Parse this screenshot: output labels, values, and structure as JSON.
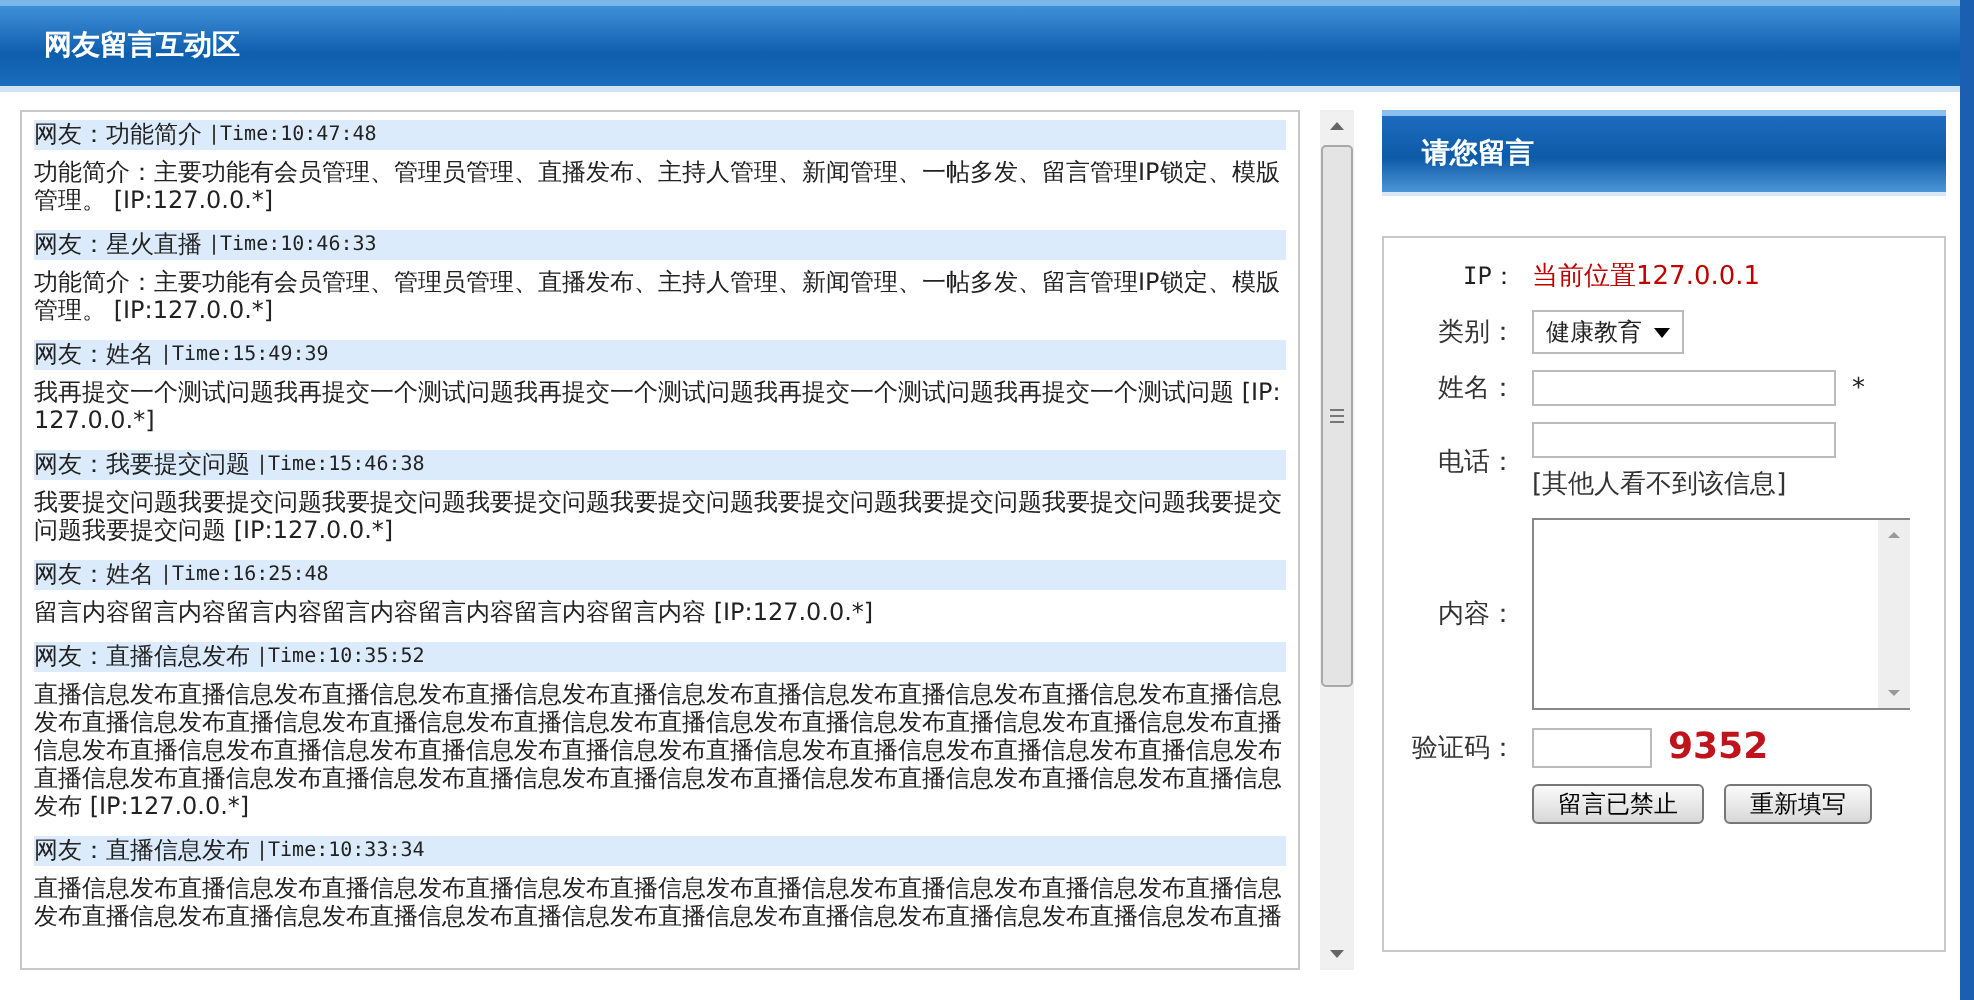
{
  "header": {
    "title": "网友留言互动区"
  },
  "messages": [
    {
      "author": "网友：功能简介",
      "time": "|Time:10:47:48",
      "body": "功能简介：主要功能有会员管理、管理员管理、直播发布、主持人管理、新闻管理、一帖多发、留言管理IP锁定、模版管理。 [IP:127.0.0.*]"
    },
    {
      "author": "网友：星火直播",
      "time": "|Time:10:46:33",
      "body": "功能简介：主要功能有会员管理、管理员管理、直播发布、主持人管理、新闻管理、一帖多发、留言管理IP锁定、模版管理。 [IP:127.0.0.*]"
    },
    {
      "author": "网友：姓名",
      "time": "|Time:15:49:39",
      "body": "我再提交一个测试问题我再提交一个测试问题我再提交一个测试问题我再提交一个测试问题我再提交一个测试问题 [IP:127.0.0.*]"
    },
    {
      "author": "网友：我要提交问题",
      "time": "|Time:15:46:38",
      "body": "我要提交问题我要提交问题我要提交问题我要提交问题我要提交问题我要提交问题我要提交问题我要提交问题我要提交问题我要提交问题 [IP:127.0.0.*]"
    },
    {
      "author": "网友：姓名",
      "time": "|Time:16:25:48",
      "body": "留言内容留言内容留言内容留言内容留言内容留言内容留言内容 [IP:127.0.0.*]"
    },
    {
      "author": "网友：直播信息发布",
      "time": "|Time:10:35:52",
      "body": "直播信息发布直播信息发布直播信息发布直播信息发布直播信息发布直播信息发布直播信息发布直播信息发布直播信息发布直播信息发布直播信息发布直播信息发布直播信息发布直播信息发布直播信息发布直播信息发布直播信息发布直播信息发布直播信息发布直播信息发布直播信息发布直播信息发布直播信息发布直播信息发布直播信息发布直播信息发布直播信息发布直播信息发布直播信息发布直播信息发布直播信息发布直播信息发布直播信息发布直播信息发布直播信息发布 [IP:127.0.0.*]"
    },
    {
      "author": "网友：直播信息发布",
      "time": "|Time:10:33:34",
      "body": "直播信息发布直播信息发布直播信息发布直播信息发布直播信息发布直播信息发布直播信息发布直播信息发布直播信息发布直播信息发布直播信息发布直播信息发布直播信息发布直播信息发布直播信息发布直播信息发布直播信息发布直播"
    }
  ],
  "form": {
    "title": "请您留言",
    "ip_label": "IP：",
    "ip_value": "当前位置127.0.0.1",
    "category_label": "类别：",
    "category_value": "健康教育",
    "name_label": "姓名：",
    "required_mark": "*",
    "phone_label": "电话：",
    "phone_note": "[其他人看不到该信息]",
    "content_label": "内容：",
    "captcha_label": "验证码：",
    "captcha_code": "9352",
    "buttons": [
      "留言已禁止",
      "重新填写"
    ]
  }
}
